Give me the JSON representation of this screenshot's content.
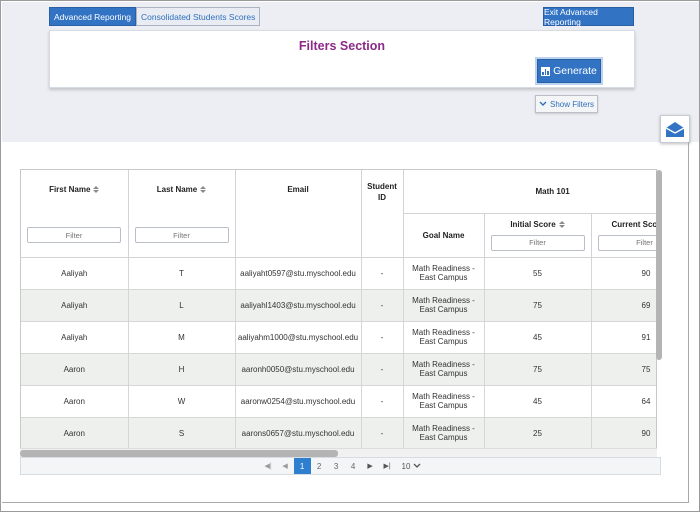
{
  "tabs": [
    {
      "label": "Advanced Reporting",
      "active": true
    },
    {
      "label": "Consolidated Students Scores",
      "active": false
    }
  ],
  "exit_label": "Exit Advanced Reporting",
  "filters": {
    "title": "Filters Section",
    "generate_label": "Generate",
    "show_filters_label": "Show Filters"
  },
  "table": {
    "headers": {
      "first_name": "First Name",
      "last_name": "Last Name",
      "email": "Email",
      "student_id": "Student ID",
      "group": "Math 101",
      "goal_name": "Goal Name",
      "initial_score": "Initial Score",
      "current_score": "Current Sco"
    },
    "filter_placeholder": "Filter",
    "rows": [
      {
        "first": "Aaliyah",
        "last": "T",
        "email": "aaliyaht0597@stu.myschool.edu",
        "id": "-",
        "goal": "Math Readiness - East Campus",
        "initial": "55",
        "current": "90"
      },
      {
        "first": "Aaliyah",
        "last": "L",
        "email": "aaliyahl1403@stu.myschool.edu",
        "id": "-",
        "goal": "Math Readiness - East Campus",
        "initial": "75",
        "current": "69"
      },
      {
        "first": "Aaliyah",
        "last": "M",
        "email": "aaliyahm1000@stu.myschool.edu",
        "id": "-",
        "goal": "Math Readiness - East Campus",
        "initial": "45",
        "current": "91"
      },
      {
        "first": "Aaron",
        "last": "H",
        "email": "aaronh0050@stu.myschool.edu",
        "id": "-",
        "goal": "Math Readiness - East Campus",
        "initial": "75",
        "current": "75"
      },
      {
        "first": "Aaron",
        "last": "W",
        "email": "aaronw0254@stu.myschool.edu",
        "id": "-",
        "goal": "Math Readiness - East Campus",
        "initial": "45",
        "current": "64"
      },
      {
        "first": "Aaron",
        "last": "S",
        "email": "aarons0657@stu.myschool.edu",
        "id": "-",
        "goal": "Math Readiness - East Campus",
        "initial": "25",
        "current": "90"
      }
    ]
  },
  "pagination": {
    "pages": [
      "1",
      "2",
      "3",
      "4"
    ],
    "current": "1",
    "page_size": "10"
  },
  "colors": {
    "primary": "#3273c4",
    "title": "#8b2a87",
    "page_active": "#2f7fd0"
  },
  "icons": [
    "bar-chart-icon",
    "chevron-down-icon",
    "mail-icon",
    "sort-icon",
    "first-page-icon",
    "prev-page-icon",
    "next-page-icon",
    "last-page-icon"
  ]
}
